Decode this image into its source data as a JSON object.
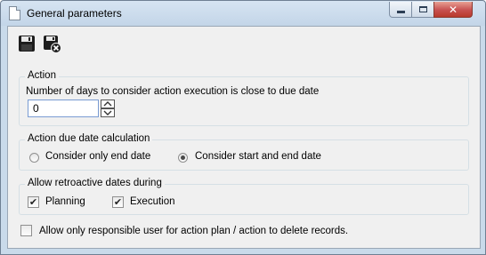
{
  "window": {
    "title": "General parameters",
    "close_glyph": "✕"
  },
  "toolbar": {
    "save_icon": "floppy-disk-icon",
    "save_close_icon": "floppy-disk-close-icon"
  },
  "action_group": {
    "legend": "Action",
    "days_label": "Number of days to consider action execution is close to due date",
    "days_value": "0"
  },
  "due_date_group": {
    "legend": "Action due date calculation",
    "options": [
      {
        "label": "Consider only end date",
        "selected": false
      },
      {
        "label": "Consider start and end date",
        "selected": true
      }
    ]
  },
  "retroactive_group": {
    "legend": "Allow retroactive dates during",
    "options": [
      {
        "label": "Planning",
        "checked": true
      },
      {
        "label": "Execution",
        "checked": true
      }
    ]
  },
  "delete_option": {
    "label": "Allow only responsible user for action plan / action to delete records.",
    "checked": false
  },
  "check_glyph": "✔"
}
